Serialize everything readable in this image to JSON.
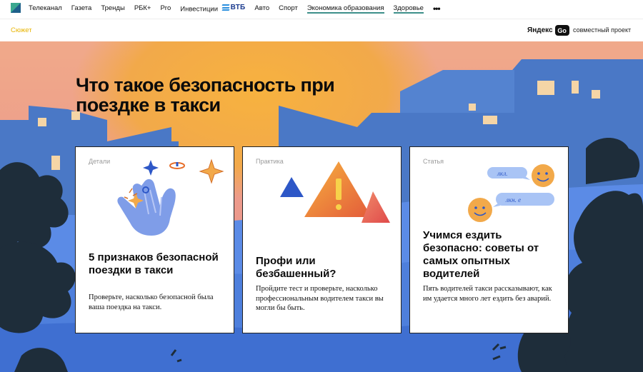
{
  "nav": {
    "items": [
      {
        "label": "Телеканал",
        "underline": false
      },
      {
        "label": "Газета",
        "underline": false
      },
      {
        "label": "Тренды",
        "underline": false
      },
      {
        "label": "РБК+",
        "underline": false
      },
      {
        "label": "Pro",
        "underline": false
      },
      {
        "label": "Инвестиции",
        "underline": false
      },
      {
        "label": "Авто",
        "underline": false
      },
      {
        "label": "Спорт",
        "underline": false
      },
      {
        "label": "Экономика образования",
        "underline": true
      },
      {
        "label": "Здоровье",
        "underline": true
      }
    ],
    "vtb_label": "ВТБ",
    "more": "•••"
  },
  "subheader": {
    "section": "Сюжет",
    "partner_name": "Яндекс",
    "partner_badge": "Go",
    "partner_note": "совместный проект"
  },
  "hero": {
    "title": "Что такое безопасность при поездке в такси"
  },
  "cards": [
    {
      "tag": "Детали",
      "title": "5 признаков безопасной поездки в такси",
      "desc": "Проверьте, насколько безопасной была ваша поездка на такси."
    },
    {
      "tag": "Практика",
      "title": "Профи или безбашенный?",
      "desc": "Пройдите тест и проверьте, насколько профессиональным водителем такси вы могли бы быть."
    },
    {
      "tag": "Статья",
      "title": "Учимся ездить безопасно: советы от самых опытных водителей",
      "desc": "Пять водителей такси рассказывают, как им удается много лет ездить без аварий.",
      "bubble_1": "лкл.",
      "bubble_2": "лкн. е"
    }
  ],
  "colors": {
    "accent_yellow": "#e8b400",
    "sky_pink": "#e98b8d",
    "sun_orange": "#f2a94a",
    "buildings_blue": "#4a78c6",
    "ground_blue": "#5b8be6",
    "tree_dark": "#1e2d3a",
    "link_teal": "#3d8f8a"
  }
}
